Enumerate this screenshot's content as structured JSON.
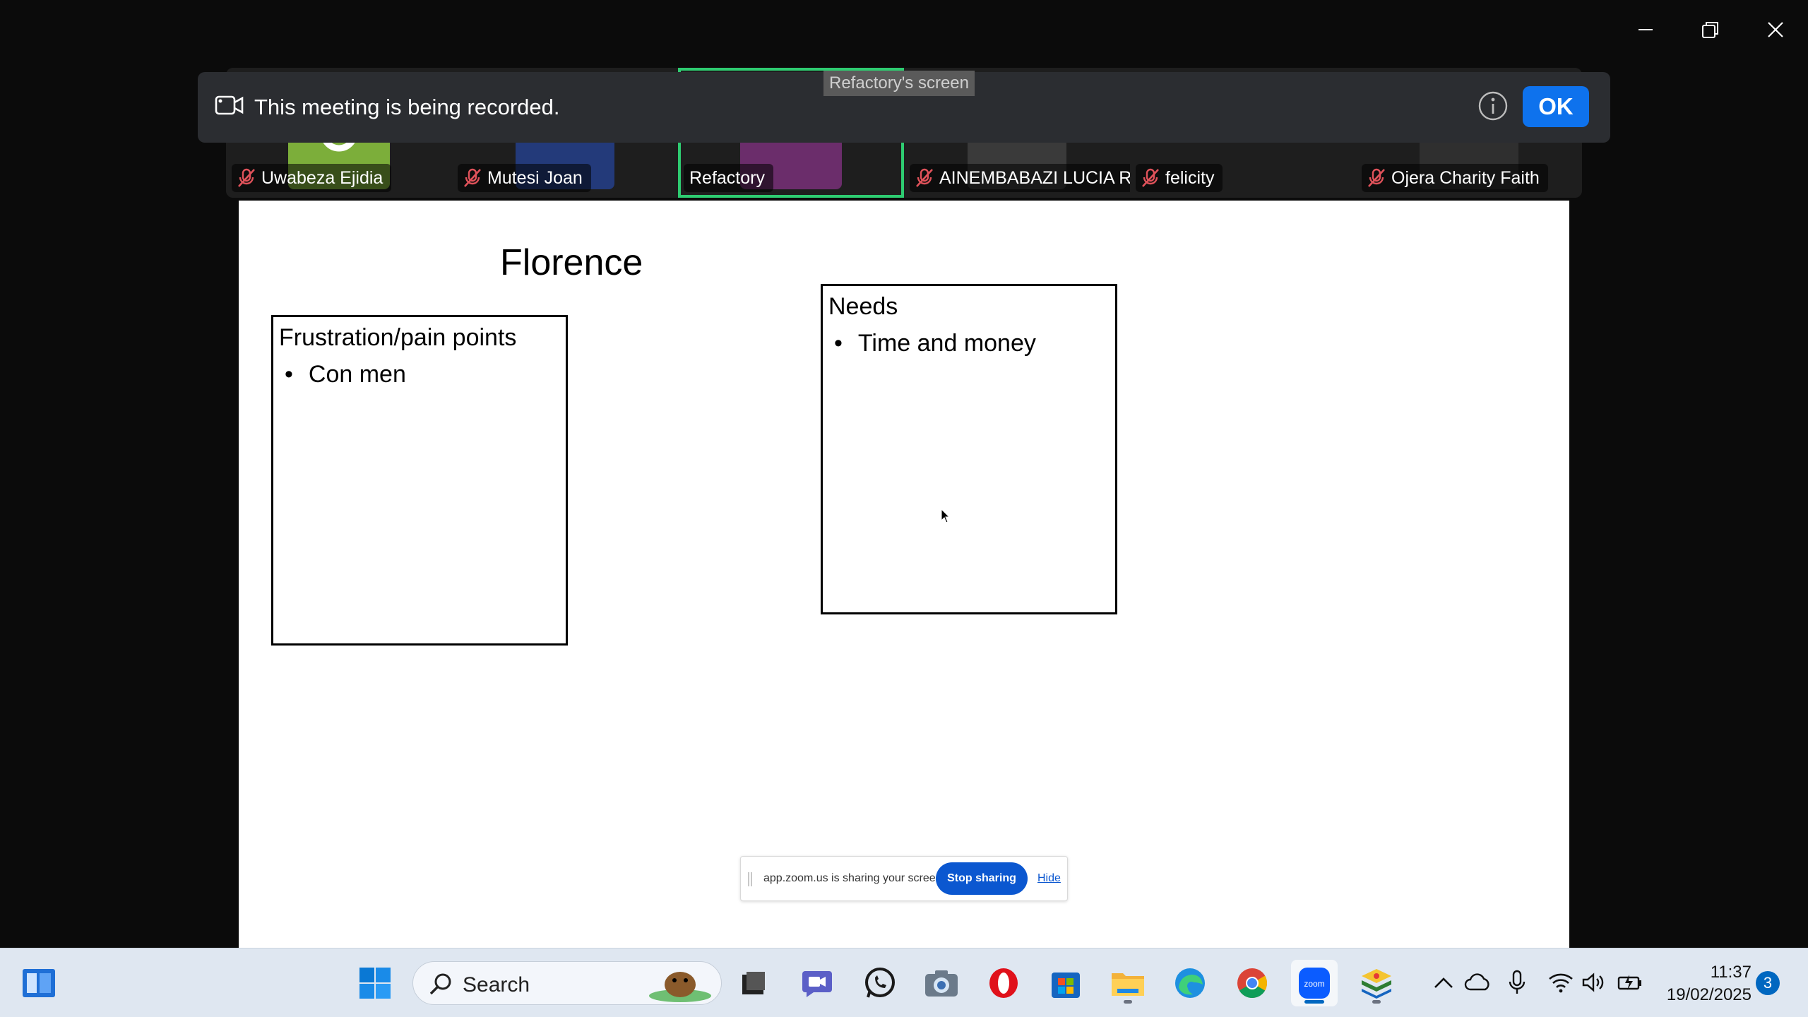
{
  "recording_banner": {
    "text": "This meeting is being recorded.",
    "ok_label": "OK"
  },
  "screen_label": "Refactory's screen",
  "participants": [
    {
      "name": "Uwabeza Ejidia",
      "muted": true
    },
    {
      "name": "Mutesi Joan",
      "muted": true
    },
    {
      "name": "Refactory",
      "muted": false,
      "active": true
    },
    {
      "name": "AINEMBABAZI LUCIA R...",
      "muted": true
    },
    {
      "name": "felicity",
      "muted": true
    },
    {
      "name": "Ojera Charity Faith",
      "muted": true
    }
  ],
  "slide": {
    "title": "Florence",
    "frustration_heading": "Frustration/pain points",
    "frustration_items": [
      "Con men"
    ],
    "needs_heading": "Needs",
    "needs_items": [
      "Time and money"
    ]
  },
  "share_notice": {
    "text": "app.zoom.us is sharing your screen.",
    "stop_label": "Stop sharing",
    "hide_label": "Hide"
  },
  "taskbar": {
    "search_label": "Search",
    "time": "11:37",
    "date": "19/02/2025",
    "notifications": "3",
    "apps": [
      "start-icon",
      "search",
      "file-manager-icon",
      "zoom-video-icon",
      "whatsapp-icon",
      "camera-icon",
      "opera-icon",
      "microsoft-store-icon",
      "file-explorer-icon",
      "edge-icon",
      "chrome-icon",
      "zoom-icon",
      "bluestacks-icon"
    ]
  },
  "colors": {
    "accent": "#0e72ed",
    "active_speaker": "#2ecc71",
    "muted": "#e0525a"
  }
}
